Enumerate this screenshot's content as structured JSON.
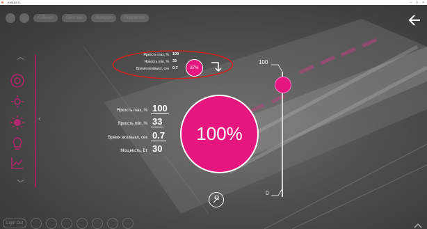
{
  "window": {
    "title": "AMADA LL"
  },
  "topnav": {
    "pills": [
      "Кабинет",
      "Свет зал",
      "Холодок",
      "Подсветка"
    ]
  },
  "overlay": {
    "rows": [
      {
        "label": "Яркость max, %",
        "value": "100"
      },
      {
        "label": "Яркость min, %",
        "value": "33"
      },
      {
        "label": "Время вкл/выкл, сек",
        "value": "0.7"
      }
    ],
    "small_circle": "87%"
  },
  "settings": {
    "rows": [
      {
        "label": "Яркость max, %",
        "value": "100"
      },
      {
        "label": "Яркость min, %",
        "value": "33"
      },
      {
        "label": "Время вкл/выкл, сек",
        "value": "0.7"
      },
      {
        "label": "Мощность, Вт",
        "value": "30"
      }
    ]
  },
  "main_circle": {
    "label": "100%"
  },
  "slider": {
    "max_label": "100",
    "min_label": "0",
    "value": 100
  },
  "bottombar": {
    "pill": "Light Out"
  },
  "colors": {
    "accent": "#e5177f",
    "annotation": "#d32020",
    "rail": "#c0185e"
  },
  "icons": {
    "back": "arrow-left-icon",
    "overlay_arrow": "arrow-down-turn-icon",
    "wrench": "wrench-icon"
  }
}
